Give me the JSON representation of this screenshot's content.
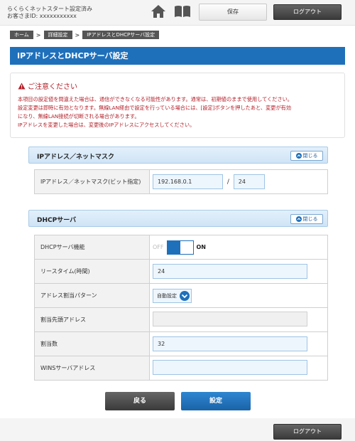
{
  "header": {
    "status_line1": "らくらくネットスタート設定済み",
    "status_line2": "お客さまID: xxxxxxxxxxx",
    "save_label": "保存",
    "logout_label": "ログアウト"
  },
  "breadcrumb": [
    "ホーム",
    "詳細設定",
    "IPアドレスとDHCPサーバ設定"
  ],
  "page_title": "IPアドレスとDHCPサーバ設定",
  "notice": {
    "title": "ご注意ください",
    "lines": [
      "本項目の設定値を間違えた場合は、通信ができなくなる可能性があります。通常は、初期値のままで使用してください。",
      "設定変更は即時に有効となります。無線LAN経由で設定を行っている場合には、[設定]ボタンを押したあと、変更が有効",
      "になり、無線LAN接続が切断される場合があります。",
      "IPアドレスを変更した場合は、変更後のIPアドレスにアクセスしてください。"
    ]
  },
  "ip_section": {
    "title": "IPアドレス／ネットマスク",
    "close_label": "閉じる",
    "label": "IPアドレス／ネットマスク(ビット指定)",
    "ip_value": "192.168.0.1",
    "separator": "/",
    "mask_value": "24"
  },
  "dhcp_section": {
    "title": "DHCPサーバ",
    "close_label": "閉じる",
    "rows": {
      "function_label": "DHCPサーバ機能",
      "toggle_off": "OFF",
      "toggle_on": "ON",
      "lease_label": "リースタイム(時間)",
      "lease_value": "24",
      "pattern_label": "アドレス割当パターン",
      "pattern_value": "自動設定",
      "start_label": "割当先頭アドレス",
      "start_value": "",
      "count_label": "割当数",
      "count_value": "32",
      "wins_label": "WINSサーバアドレス",
      "wins_value": ""
    }
  },
  "actions": {
    "back_label": "戻る",
    "submit_label": "設定"
  },
  "colors": {
    "accent": "#1f70bb",
    "warning": "#b3202a",
    "dark_button": "#444444"
  }
}
